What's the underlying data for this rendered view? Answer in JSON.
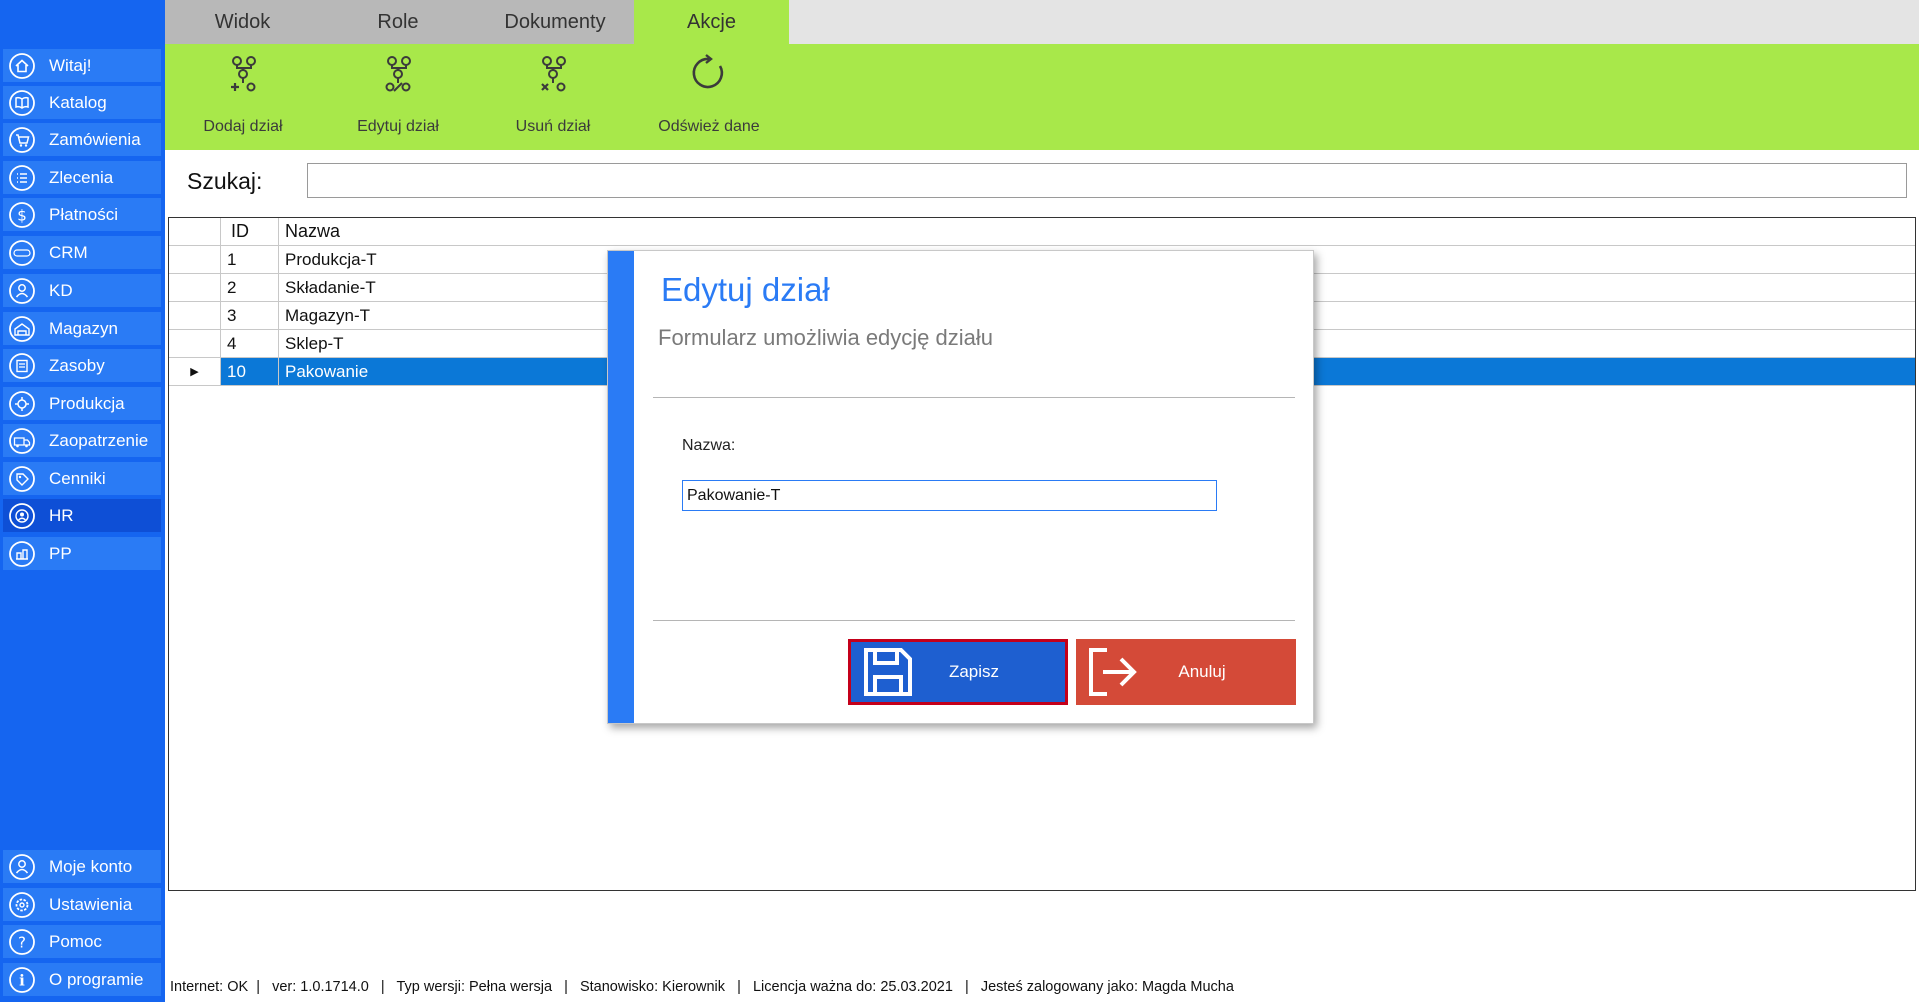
{
  "sidebar": {
    "top_items": [
      {
        "label": "Witaj!",
        "icon": "home-icon"
      },
      {
        "label": "Katalog",
        "icon": "book-icon"
      },
      {
        "label": "Zamówienia",
        "icon": "cart-icon"
      },
      {
        "label": "Zlecenia",
        "icon": "list-icon"
      },
      {
        "label": "Płatności",
        "icon": "dollar-icon"
      },
      {
        "label": "CRM",
        "icon": "crm-icon"
      },
      {
        "label": "KD",
        "icon": "person-icon"
      },
      {
        "label": "Magazyn",
        "icon": "warehouse-icon"
      },
      {
        "label": "Zasoby",
        "icon": "resources-icon"
      },
      {
        "label": "Produkcja",
        "icon": "production-icon"
      },
      {
        "label": "Zaopatrzenie",
        "icon": "truck-icon"
      },
      {
        "label": "Cenniki",
        "icon": "tag-icon"
      },
      {
        "label": "HR",
        "icon": "hr-icon",
        "active": true
      },
      {
        "label": "PP",
        "icon": "pp-icon"
      }
    ],
    "bottom_items": [
      {
        "label": "Moje konto",
        "icon": "account-icon"
      },
      {
        "label": "Ustawienia",
        "icon": "settings-icon"
      },
      {
        "label": "Pomoc",
        "icon": "help-icon"
      },
      {
        "label": "O programie",
        "icon": "info-icon"
      }
    ]
  },
  "tabs": [
    {
      "label": "Widok"
    },
    {
      "label": "Role"
    },
    {
      "label": "Dokumenty"
    },
    {
      "label": "Akcje",
      "active": true
    }
  ],
  "ribbon": {
    "buttons": [
      {
        "label": "Dodaj dział",
        "icon": "add-department-icon"
      },
      {
        "label": "Edytuj dział",
        "icon": "edit-department-icon"
      },
      {
        "label": "Usuń dział",
        "icon": "delete-department-icon"
      },
      {
        "label": "Odśwież dane",
        "icon": "refresh-icon"
      }
    ]
  },
  "search": {
    "label": "Szukaj:",
    "value": ""
  },
  "grid": {
    "columns": [
      "ID",
      "Nazwa"
    ],
    "rows": [
      {
        "id": "1",
        "name": "Produkcja-T"
      },
      {
        "id": "2",
        "name": "Składanie-T"
      },
      {
        "id": "3",
        "name": "Magazyn-T"
      },
      {
        "id": "4",
        "name": "Sklep-T"
      },
      {
        "id": "10",
        "name": "Pakowanie",
        "selected": true
      }
    ]
  },
  "modal": {
    "title": "Edytuj dział",
    "subtitle": "Formularz umożliwia edycję działu",
    "field_label": "Nazwa:",
    "field_value": "Pakowanie-T",
    "save_label": "Zapisz",
    "cancel_label": "Anuluj"
  },
  "status": {
    "text": "Internet: OK  |   ver: 1.0.1714.0   |   Typ wersji: Pełna wersja   |   Stanowisko: Kierownik   |   Licencja ważna do: 25.03.2021   |   Jesteś zalogowany jako: Magda Mucha"
  },
  "colors": {
    "sidebar_bg": "#1565f0",
    "ribbon_bg": "#a8e84a",
    "selection": "#0b78d7",
    "save_button": "#1e5fd0",
    "cancel_button": "#d44a38"
  }
}
